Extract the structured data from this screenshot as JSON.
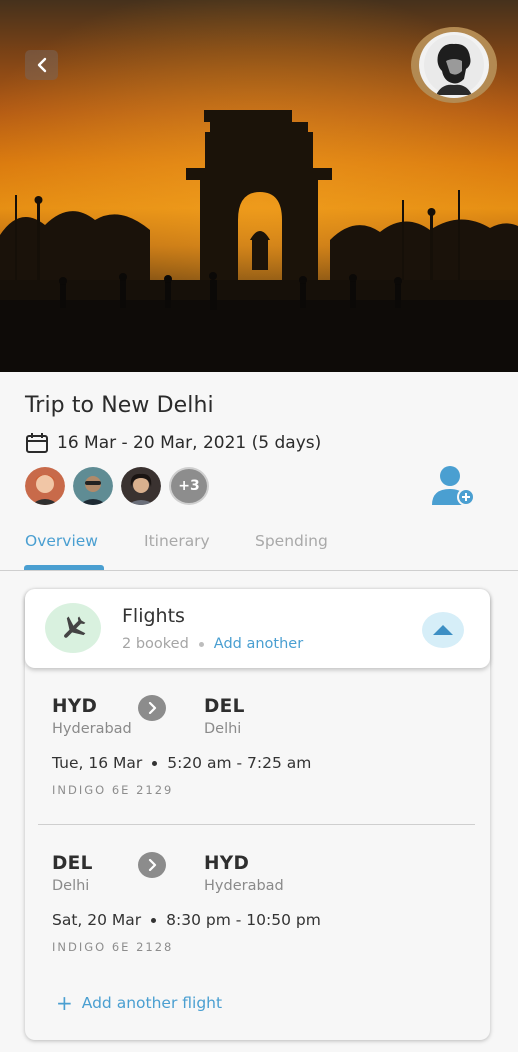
{
  "hero": {
    "back_icon": "chevron-left-icon",
    "profile_avatar": "user-avatar-photo"
  },
  "trip": {
    "title": "Trip to New Delhi",
    "calendar_icon": "calendar-icon",
    "dates": "16 Mar - 20 Mar, 2021 (5 days)",
    "members": [
      {
        "name": "member-avatar-1",
        "color": "#c86a4a"
      },
      {
        "name": "member-avatar-2",
        "color": "#5f8c94"
      },
      {
        "name": "member-avatar-3",
        "color": "#3a3230"
      }
    ],
    "more_members": "+3",
    "add_member_icon": "add-user-icon"
  },
  "tabs": [
    {
      "label": "Overview",
      "active": true
    },
    {
      "label": "Itinerary",
      "active": false
    },
    {
      "label": "Spending",
      "active": false
    }
  ],
  "flights": {
    "title": "Flights",
    "booked": "2 booked",
    "add_another": "Add another",
    "list": [
      {
        "from_code": "HYD",
        "from_city": "Hyderabad",
        "to_code": "DEL",
        "to_city": "Delhi",
        "date": "Tue, 16 Mar",
        "time": "5:20 am - 7:25 am",
        "carrier": "INDIGO 6E 2129"
      },
      {
        "from_code": "DEL",
        "from_city": "Delhi",
        "to_code": "HYD",
        "to_city": "Hyderabad",
        "date": "Sat, 20 Mar",
        "time": "8:30 pm - 10:50 pm",
        "carrier": "INDIGO 6E 2128"
      }
    ],
    "add_flight": "Add another flight"
  },
  "colors": {
    "accent": "#4a9fd1",
    "plane_bg": "#d9f1df",
    "collapse_bg": "#d6eef8"
  }
}
